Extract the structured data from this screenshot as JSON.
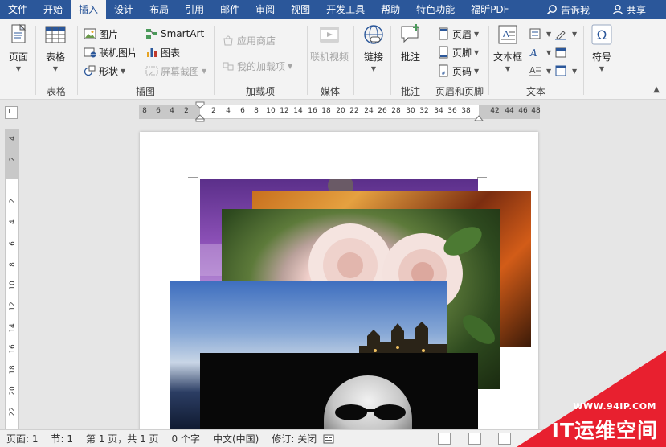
{
  "menu": {
    "tabs": [
      "文件",
      "开始",
      "插入",
      "设计",
      "布局",
      "引用",
      "邮件",
      "审阅",
      "视图",
      "开发工具",
      "帮助",
      "特色功能",
      "福昕PDF"
    ],
    "active_tab": "插入",
    "tell_me": "告诉我",
    "share": "共享"
  },
  "ribbon": {
    "pages": {
      "label": "页面",
      "group": ""
    },
    "table": {
      "label": "表格",
      "group": "表格"
    },
    "illustrations": {
      "group": "插图",
      "picture": "图片",
      "online_picture": "联机图片",
      "shapes": "形状",
      "smartart": "SmartArt",
      "chart": "图表",
      "screenshot": "屏幕截图"
    },
    "addins": {
      "group": "加载项",
      "store": "应用商店",
      "my_addins": "我的加载项"
    },
    "media": {
      "group": "媒体",
      "online_video": "联机视频"
    },
    "links": {
      "label": "链接",
      "group": ""
    },
    "comments": {
      "group": "批注",
      "comment": "批注"
    },
    "header_footer": {
      "group": "页眉和页脚",
      "header": "页眉",
      "footer": "页脚",
      "page_number": "页码"
    },
    "text": {
      "group": "文本",
      "textbox": "文本框"
    },
    "symbols": {
      "label": "符号",
      "group": ""
    }
  },
  "ruler": {
    "h_labels": [
      "8",
      "6",
      "4",
      "2",
      "2",
      "4",
      "6",
      "8",
      "10",
      "12",
      "14",
      "16",
      "18",
      "20",
      "22",
      "24",
      "26",
      "28",
      "30",
      "32",
      "34",
      "36",
      "38",
      "42",
      "44",
      "46",
      "48"
    ],
    "v_labels": [
      "4",
      "2",
      "2",
      "4",
      "6",
      "8",
      "10",
      "12",
      "14",
      "16",
      "18",
      "20",
      "22"
    ]
  },
  "status": {
    "page": "页面: 1",
    "section": "节: 1",
    "page_of": "第 1 页，共 1 页",
    "words": "0 个字",
    "language": "中文(中国)",
    "track_changes": "修订: 关闭"
  },
  "watermark": {
    "url": "WWW.94IP.COM",
    "name": "IT运维空间"
  },
  "colors": {
    "title_blue": "#2b579a",
    "watermark_red": "#e8202f"
  }
}
